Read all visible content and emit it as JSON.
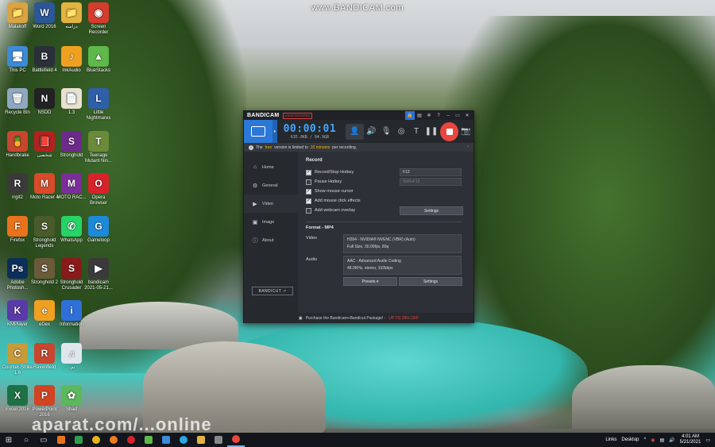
{
  "watermark": "www.BANDICAM.com",
  "watermark2": "aparat.com/...online",
  "desktop_icons": [
    {
      "label": "Malakoff",
      "color": "#d9a441",
      "glyph": "📁"
    },
    {
      "label": "Word 2016",
      "color": "#2b5797",
      "glyph": "W"
    },
    {
      "label": "دراسه",
      "color": "#e3b341",
      "glyph": "📁"
    },
    {
      "label": "Screen Recorder",
      "color": "#d43c2c",
      "glyph": "◉"
    },
    {
      "label": "This PC",
      "color": "#3c8ad8",
      "glyph": "🖥"
    },
    {
      "label": "Battlefield 4",
      "color": "#2a2f3a",
      "glyph": "B"
    },
    {
      "label": "mkAudio",
      "color": "#f0a020",
      "glyph": "♪"
    },
    {
      "label": "BlueStacks",
      "color": "#5fb84a",
      "glyph": "▲"
    },
    {
      "label": "Recycle Bin",
      "color": "#8fa8c0",
      "glyph": "🗑"
    },
    {
      "label": "NSDD",
      "color": "#222",
      "glyph": "N"
    },
    {
      "label": "1.3",
      "color": "#e9e2cf",
      "glyph": "📄"
    },
    {
      "label": "Little Nightmares",
      "color": "#2f5fa8",
      "glyph": "L"
    },
    {
      "label": "Handbrake",
      "color": "#c8462e",
      "glyph": "🍍"
    },
    {
      "label": "شخصی",
      "color": "#b3221e",
      "glyph": "📕"
    },
    {
      "label": "Stronghold",
      "color": "#6c2a8a",
      "glyph": "S"
    },
    {
      "label": "Teenage Mutant Nin...",
      "color": "#6b8a3a",
      "glyph": "T"
    },
    {
      "label": "rrgit2",
      "color": "#3a3a3a",
      "glyph": "R"
    },
    {
      "label": "Moto Racer 4",
      "color": "#d84a2a",
      "glyph": "M"
    },
    {
      "label": "MOTO RAC...",
      "color": "#7a2e9a",
      "glyph": "M"
    },
    {
      "label": "Opera Browser",
      "color": "#d8222a",
      "glyph": "O"
    },
    {
      "label": "Firefox",
      "color": "#e8731c",
      "glyph": "F"
    },
    {
      "label": "Stronghold Legends",
      "color": "#4a5a2a",
      "glyph": "S"
    },
    {
      "label": "WhatsApp",
      "color": "#25d366",
      "glyph": "✆"
    },
    {
      "label": "Gameloop",
      "color": "#1c8ad8",
      "glyph": "G"
    },
    {
      "label": "Adobe Photosh...",
      "color": "#0b2f5a",
      "glyph": "Ps"
    },
    {
      "label": "Stronghold 2",
      "color": "#6a5a3a",
      "glyph": "S"
    },
    {
      "label": "Stronghold Crusader",
      "color": "#8a1a1a",
      "glyph": "S"
    },
    {
      "label": "bandicam 2021-05-21...",
      "color": "#3a3a3a",
      "glyph": "▶"
    },
    {
      "label": "KMPlayer",
      "color": "#5a3aa8",
      "glyph": "K"
    },
    {
      "label": "eDex",
      "color": "#f0a020",
      "glyph": "e"
    },
    {
      "label": "Information",
      "color": "#2f6fd9",
      "glyph": "i"
    },
    {
      "label": "",
      "color": "#333",
      "glyph": ""
    },
    {
      "label": "Counter-Strike 1.6",
      "color": "#c79a3a",
      "glyph": "C"
    },
    {
      "label": "Ravenfield",
      "color": "#c8462e",
      "glyph": "R"
    },
    {
      "label": "..تم",
      "color": "#e0e6ee",
      "glyph": "♫"
    },
    {
      "label": "",
      "color": "#333",
      "glyph": ""
    },
    {
      "label": "Excel 2016",
      "color": "#1e7145",
      "glyph": "X"
    },
    {
      "label": "PowerPoint 2016",
      "color": "#d04423",
      "glyph": "P"
    },
    {
      "label": "Shad",
      "color": "#5cb85c",
      "glyph": "✿"
    }
  ],
  "bandicam": {
    "logo": "BANDICAM",
    "badge": "UNREGISTERED",
    "timer": "00:00:01",
    "size": "635.0KB / 94.9GB",
    "notice": {
      "pre": "The",
      "free": "free",
      "mid": "version is limited to",
      "limit": "10 minutes",
      "post": "per recording."
    },
    "nav": [
      {
        "label": "Home",
        "icon": "⌂"
      },
      {
        "label": "General",
        "icon": "⚙"
      },
      {
        "label": "Video",
        "icon": "▶"
      },
      {
        "label": "Image",
        "icon": "▣"
      },
      {
        "label": "About",
        "icon": "ⓘ"
      }
    ],
    "bandicut_label": "BANDICUT ↗",
    "record_section": "Record",
    "options": [
      {
        "label": "Record/Stop Hotkey",
        "checked": true,
        "field": "F12",
        "dim": false
      },
      {
        "label": "Pause Hotkey",
        "checked": false,
        "field": "Shift+F12",
        "dim": true
      },
      {
        "label": "Show mouse cursor",
        "checked": true
      },
      {
        "label": "Add mouse click effects",
        "checked": true
      },
      {
        "label": "Add webcam overlay",
        "checked": false
      }
    ],
    "settings_label": "Settings",
    "format_label": "Format - MP4",
    "video_label": "Video",
    "video_line1": "H264 - NVIDIA® NVENC (VBR) (Auto)",
    "video_line2": "Full Size, 30.00fps, 80q",
    "audio_label": "Audio",
    "audio_line1": "AAC - Advanced Audio Coding",
    "audio_line2": "48.0KHz, stereo, 192kbps",
    "presets_label": "Presets",
    "settings2_label": "Settings",
    "footer_text": "Purchase the Bandicam+Bandicut Package! -",
    "footer_offer": "UP TO 29% OFF"
  },
  "taskbar": {
    "links": "Links",
    "desktop": "Desktop",
    "time": "4:01 AM",
    "date": "5/21/2021"
  }
}
